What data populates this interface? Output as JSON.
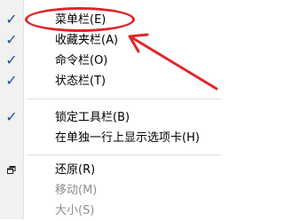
{
  "menu": {
    "items": [
      {
        "label": "菜单栏(E)",
        "checked": true,
        "disabled": false
      },
      {
        "label": "收藏夹栏(A)",
        "checked": true,
        "disabled": false
      },
      {
        "label": "命令栏(O)",
        "checked": true,
        "disabled": false
      },
      {
        "label": "状态栏(T)",
        "checked": true,
        "disabled": false
      },
      {
        "label": "锁定工具栏(B)",
        "checked": true,
        "disabled": false
      },
      {
        "label": "在单独一行上显示选项卡(H)",
        "checked": false,
        "disabled": false
      },
      {
        "label": "还原(R)",
        "checked": false,
        "disabled": false,
        "icon": "restore-icon"
      },
      {
        "label": "移动(M)",
        "checked": false,
        "disabled": true
      },
      {
        "label": "大小(S)",
        "checked": false,
        "disabled": true
      }
    ],
    "check_glyph": "✓"
  },
  "annotation": {
    "color": "#e0262a",
    "target": "菜单栏(E)"
  },
  "colors": {
    "check": "#1b4f9c",
    "gutter": "#f1f1f1",
    "disabled_text": "#8d8d8d"
  }
}
